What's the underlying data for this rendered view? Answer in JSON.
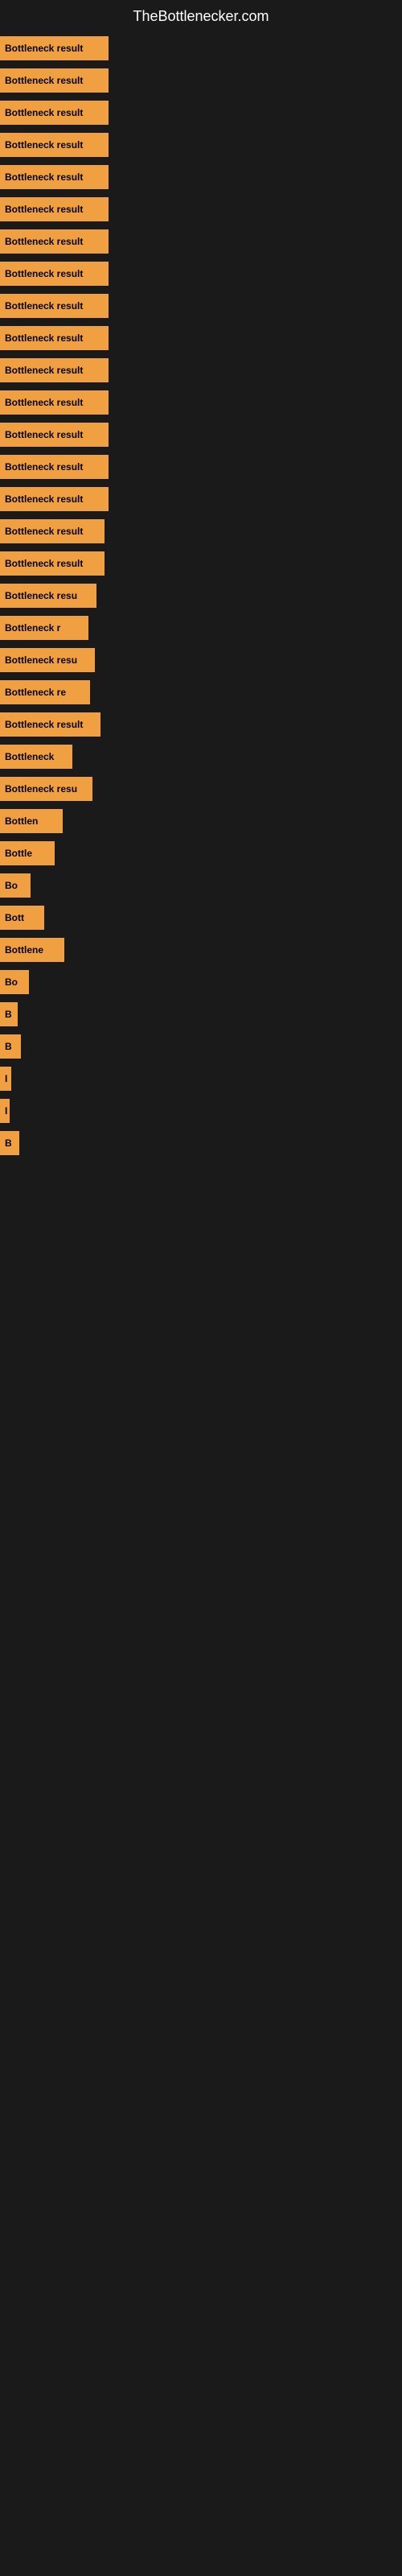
{
  "site": {
    "title": "TheBottlenecker.com"
  },
  "bars": [
    {
      "label": "Bottleneck result",
      "width": 135
    },
    {
      "label": "Bottleneck result",
      "width": 135
    },
    {
      "label": "Bottleneck result",
      "width": 135
    },
    {
      "label": "Bottleneck result",
      "width": 135
    },
    {
      "label": "Bottleneck result",
      "width": 135
    },
    {
      "label": "Bottleneck result",
      "width": 135
    },
    {
      "label": "Bottleneck result",
      "width": 135
    },
    {
      "label": "Bottleneck result",
      "width": 135
    },
    {
      "label": "Bottleneck result",
      "width": 135
    },
    {
      "label": "Bottleneck result",
      "width": 135
    },
    {
      "label": "Bottleneck result",
      "width": 135
    },
    {
      "label": "Bottleneck result",
      "width": 135
    },
    {
      "label": "Bottleneck result",
      "width": 135
    },
    {
      "label": "Bottleneck result",
      "width": 135
    },
    {
      "label": "Bottleneck result",
      "width": 135
    },
    {
      "label": "Bottleneck result",
      "width": 130
    },
    {
      "label": "Bottleneck result",
      "width": 130
    },
    {
      "label": "Bottleneck resu",
      "width": 120
    },
    {
      "label": "Bottleneck r",
      "width": 110
    },
    {
      "label": "Bottleneck resu",
      "width": 118
    },
    {
      "label": "Bottleneck re",
      "width": 112
    },
    {
      "label": "Bottleneck result",
      "width": 125
    },
    {
      "label": "Bottleneck",
      "width": 90
    },
    {
      "label": "Bottleneck resu",
      "width": 115
    },
    {
      "label": "Bottlen",
      "width": 78
    },
    {
      "label": "Bottle",
      "width": 68
    },
    {
      "label": "Bo",
      "width": 38
    },
    {
      "label": "Bott",
      "width": 55
    },
    {
      "label": "Bottlene",
      "width": 80
    },
    {
      "label": "Bo",
      "width": 36
    },
    {
      "label": "B",
      "width": 22
    },
    {
      "label": "B",
      "width": 26
    },
    {
      "label": "I",
      "width": 14
    },
    {
      "label": "I",
      "width": 12
    },
    {
      "label": "B",
      "width": 24
    }
  ]
}
